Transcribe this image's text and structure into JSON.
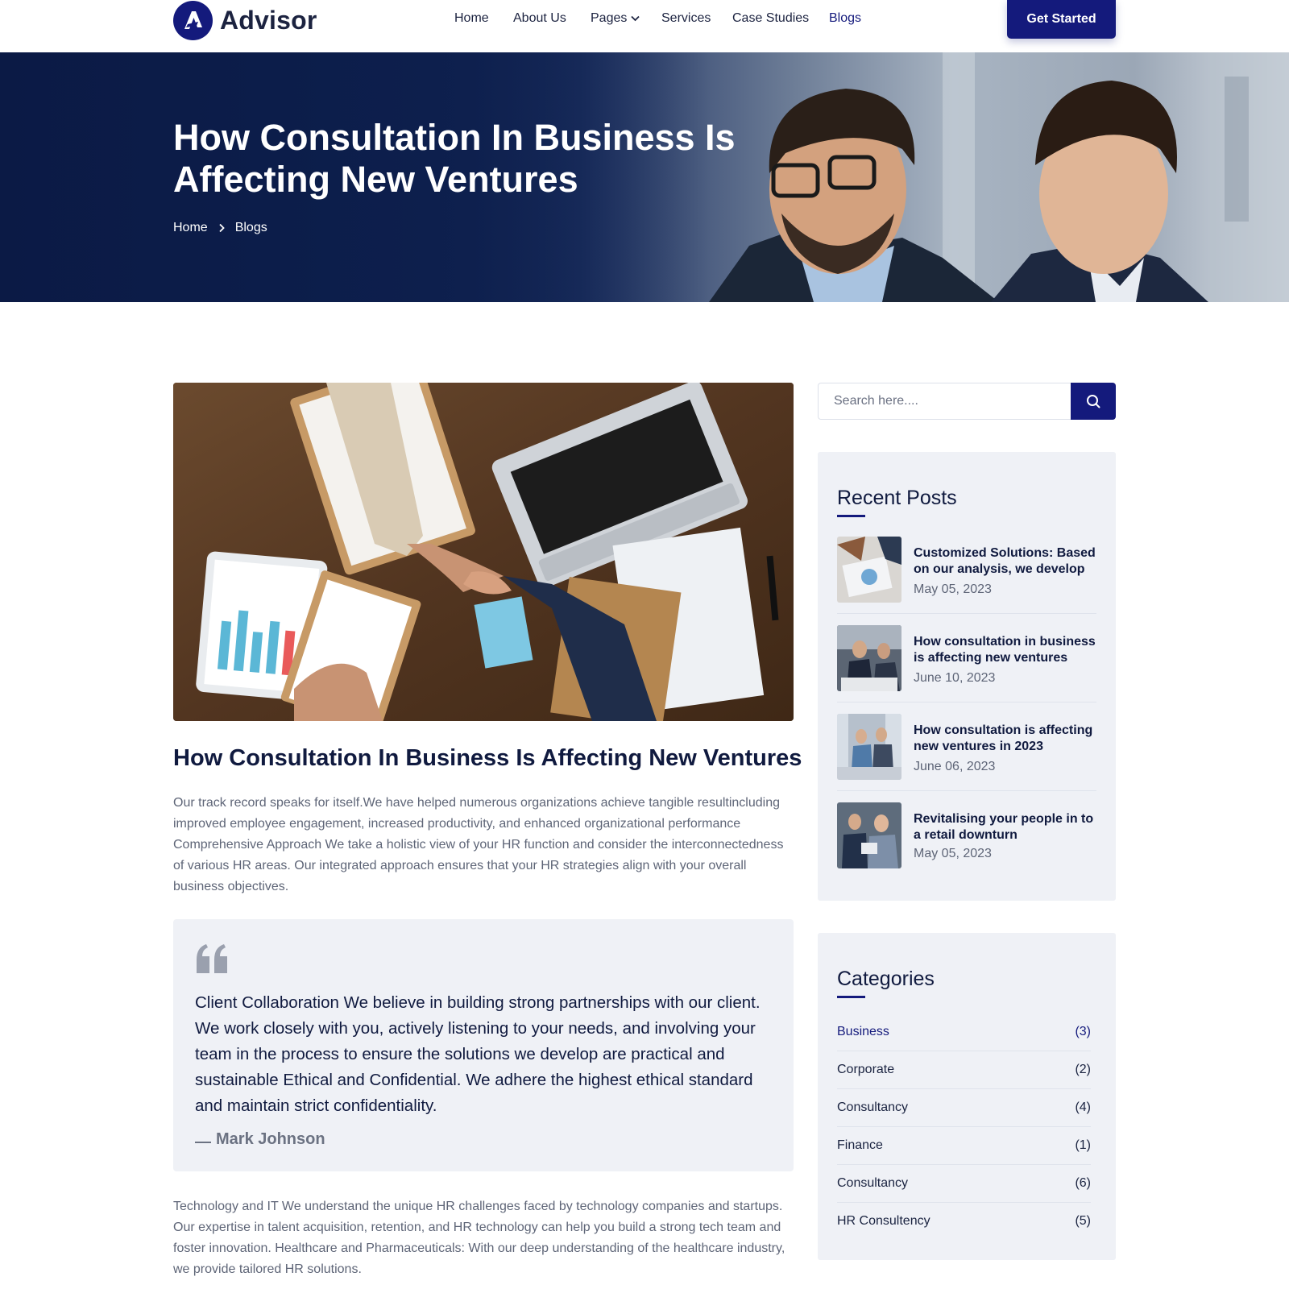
{
  "brand": {
    "name": "Advisor",
    "accent": "#141a7c",
    "dark": "#101a3f"
  },
  "nav": {
    "items": [
      "Home",
      "About Us",
      "Pages",
      "Services",
      "Case Studies",
      "Blogs"
    ],
    "active": "Blogs",
    "cta_label": "Get Started"
  },
  "hero": {
    "title": "How Consultation In Business Is Affecting New Ventures",
    "breadcrumb": [
      "Home",
      "Blogs"
    ]
  },
  "article": {
    "title": "How Consultation In Business Is Affecting New Ventures",
    "intro": "Our track record speaks for itself.We have helped numerous organizations achieve tangible resultincluding improved employee engagement, increased productivity, and enhanced organizational performance Comprehensive Approach We take a holistic view of your HR function and consider the interconnectedness of various HR areas. Our integrated approach ensures that your HR strategies align with your overall business objectives.",
    "quote": {
      "text": "Client Collaboration We believe in building strong partnerships with our client. We work closely with you, actively listening to your needs, and involving your team in the process to ensure the solutions we develop are practical and sustainable Ethical and Confidential. We adhere the highest ethical standard and maintain strict confidentiality.",
      "author": "Mark Johnson"
    },
    "body": "Technology and IT We understand the unique HR challenges faced by technology companies and startups. Our expertise in talent acquisition, retention, and HR technology can help you build a strong tech team and foster innovation. Healthcare and Pharmaceuticals: With our deep understanding of the healthcare industry, we provide tailored HR solutions."
  },
  "sidebar": {
    "search": {
      "placeholder": "Search here....",
      "value": ""
    },
    "recent": {
      "title": "Recent Posts",
      "posts": [
        {
          "title": "Customized Solutions: Based on our analysis, we develop",
          "date": "May 05, 2023"
        },
        {
          "title": "How consultation in business is affecting new ventures",
          "date": "June 10, 2023"
        },
        {
          "title": "How consultation is affecting new ventures in 2023",
          "date": "June 06, 2023"
        },
        {
          "title": "Revitalising your people in to a retail downturn",
          "date": "May 05, 2023"
        }
      ]
    },
    "categories": {
      "title": "Categories",
      "items": [
        {
          "name": "Business",
          "count": "(3)"
        },
        {
          "name": "Corporate",
          "count": "(2)"
        },
        {
          "name": "Consultancy",
          "count": "(4)"
        },
        {
          "name": "Finance",
          "count": "(1)"
        },
        {
          "name": "Consultancy",
          "count": "(6)"
        },
        {
          "name": "HR Consultency",
          "count": "(5)"
        }
      ]
    }
  }
}
